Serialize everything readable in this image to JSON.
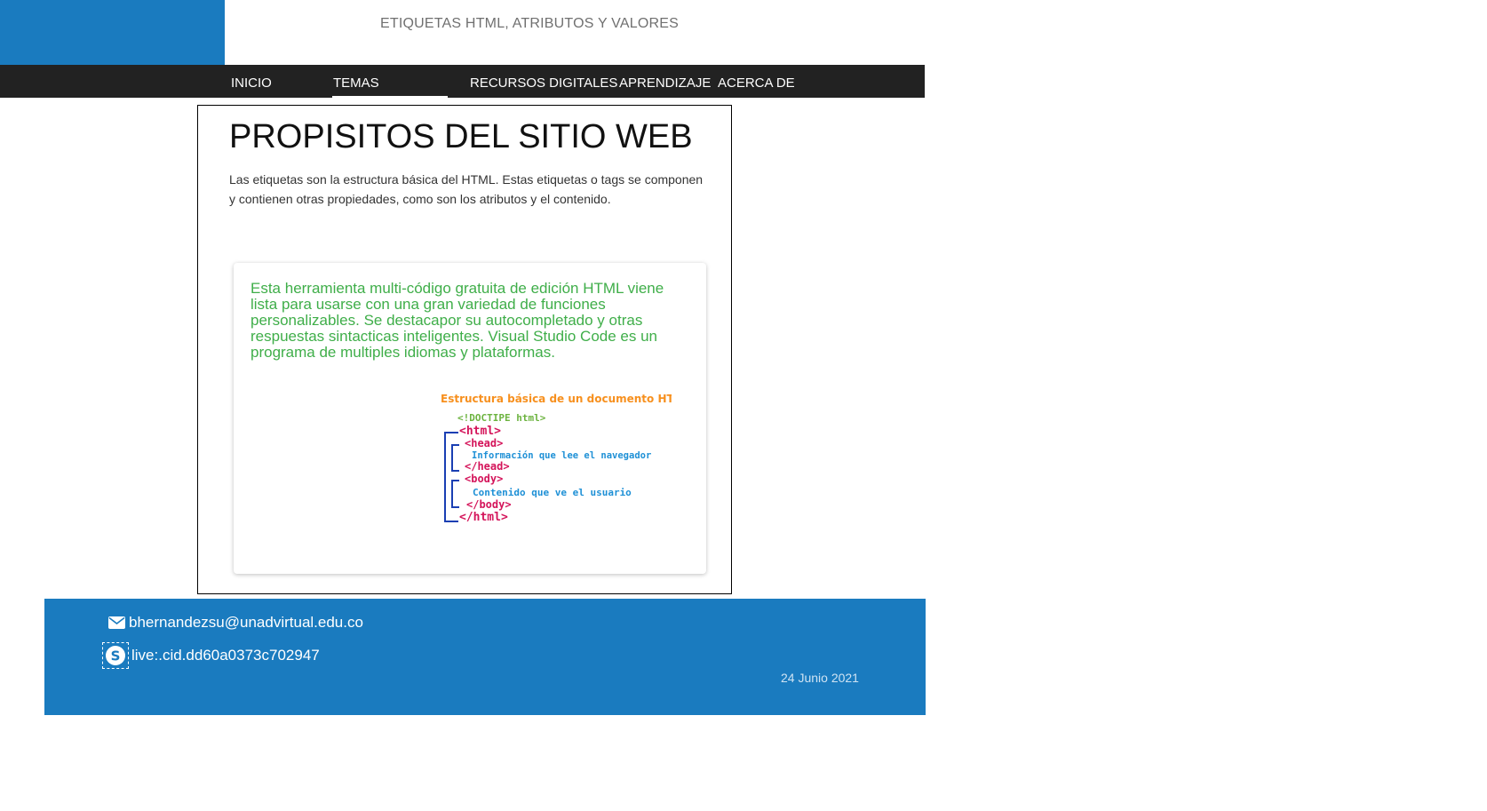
{
  "header": {
    "subtitle": "ETIQUETAS HTML, ATRIBUTOS Y VALORES",
    "brand_color": "#1a7bbf"
  },
  "nav": {
    "items": [
      {
        "label": "INICIO"
      },
      {
        "label": "TEMAS",
        "active": true
      },
      {
        "label": "RECURSOS DIGITALES"
      },
      {
        "label": "APRENDIZAJE"
      },
      {
        "label": "ACERCA DE"
      }
    ],
    "background": "#222222"
  },
  "main": {
    "title": "PROPISITOS DEL SITIO WEB",
    "intro": "Las etiquetas son la estructura básica del HTML. Estas etiquetas o tags se componen y contienen otras propiedades, como son los atributos y el contenido.",
    "card": {
      "text": "Esta herramienta multi-código gratuita de edición HTML viene lista para usarse con una gran variedad de funciones personalizables. Se destacapor su autocompletado y otras respuestas sintacticas inteligentes. Visual Studio Code es un programa de multiples idiomas y plataformas.",
      "text_color": "#3fae49",
      "diagram": {
        "title": "Estructura básica de un documento HTML",
        "doctype": "<!DOCTIPE html>",
        "html_open": "<html>",
        "head_open": "<head>",
        "head_content": "Información que lee el navegador",
        "head_close": "</head>",
        "body_open": "<body>",
        "body_content": "Contenido que ve el usuario",
        "body_close": "</body>",
        "html_close": "</html>"
      }
    }
  },
  "footer": {
    "email": "bhernandezsu@unadvirtual.edu.co",
    "skype": "live:.cid.dd60a0373c702947",
    "date": "24 Junio 2021",
    "icons": {
      "email": "envelope-icon",
      "skype": "skype-icon"
    }
  }
}
